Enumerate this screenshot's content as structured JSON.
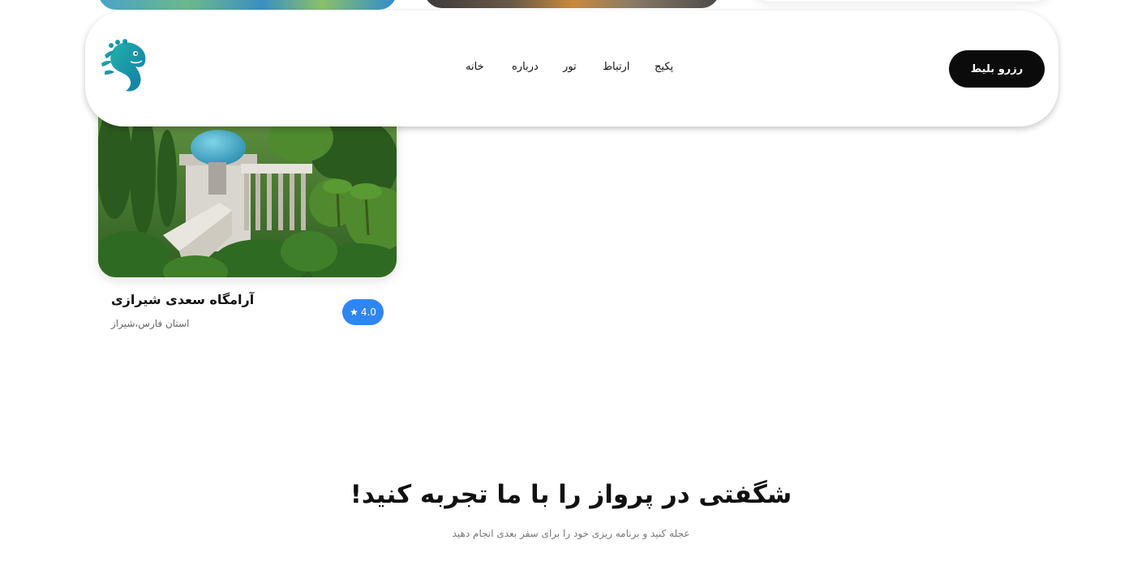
{
  "header": {
    "book_button": "رزرو بلیط",
    "nav": [
      "پکیج",
      "ارتباط",
      "تور",
      "درباره",
      "خانه"
    ]
  },
  "card": {
    "title": "آرامگاه سعدی شیرازی",
    "location": "استان فارس،شیراز",
    "rating": "4.0",
    "star": "★"
  },
  "hero": {
    "title": "شگفتی در پرواز را با ما تجربه کنید!",
    "subtitle": "عجله کنید و برنامه ریزی خود را برای سفر بعدی انجام دهید"
  },
  "colors": {
    "accent": "#2f86f2",
    "button": "#0b0b0b",
    "logo": "#17a5a5"
  }
}
